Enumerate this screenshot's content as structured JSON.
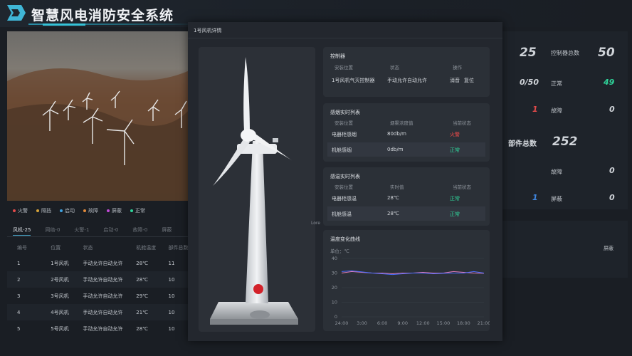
{
  "header": {
    "title": "智慧风电消防安全系统"
  },
  "legend": [
    {
      "label": "火警",
      "color": "#e24a4a"
    },
    {
      "label": "隔挡",
      "color": "#d6a33a"
    },
    {
      "label": "启动",
      "color": "#3fa2e0"
    },
    {
      "label": "故障",
      "color": "#e0893a"
    },
    {
      "label": "屏蔽",
      "color": "#c24ad8"
    },
    {
      "label": "正常",
      "color": "#2fd49a"
    }
  ],
  "filter_tabs": [
    "风机-25",
    "网络-0",
    "火警-1",
    "启动-0",
    "故障-0",
    "屏蔽"
  ],
  "table": {
    "headers": [
      "编号",
      "位置",
      "状态",
      "机舱温度",
      "部件总数"
    ],
    "rows": [
      [
        "1",
        "1号风机",
        "手动允许自动允许",
        "28℃",
        "11"
      ],
      [
        "2",
        "2号风机",
        "手动允许自动允许",
        "28℃",
        "10"
      ],
      [
        "3",
        "3号风机",
        "手动允许自动允许",
        "29℃",
        "10"
      ],
      [
        "4",
        "4号风机",
        "手动允许自动允许",
        "21℃",
        "10"
      ],
      [
        "5",
        "5号风机",
        "手动允许自动允许",
        "28℃",
        "10"
      ]
    ]
  },
  "right_stats": {
    "v25": "25",
    "controller_total_label": "控制器总数",
    "controller_total": "50",
    "ratio": "0/50",
    "normal_label": "正常",
    "normal_value": "49",
    "red1": "1",
    "fault_label": "故障",
    "fault_value": "0",
    "parts_total_label": "部件总数",
    "parts_total": "252",
    "fault2_label": "故障",
    "fault2_value": "0",
    "blue1": "1",
    "shield_label": "屏蔽",
    "shield_value": "0",
    "shield2_label": "屏蔽"
  },
  "modal": {
    "title": "1号风机详情",
    "lore": "Lore",
    "controller": {
      "title": "控制器",
      "headers": [
        "安装位置",
        "状态",
        "操作"
      ],
      "row": {
        "location": "1号风机气灭控制器",
        "status": "手动允许自动允许",
        "mute": "消音",
        "reset": "复位"
      }
    },
    "smoke": {
      "title": "感烟实时列表",
      "headers": [
        "安装位置",
        "烟雾浓度值",
        "当前状态"
      ],
      "rows": [
        {
          "location": "电器柜感烟",
          "value": "80db/m",
          "state": "火警"
        },
        {
          "location": "机舱感烟",
          "value": "0db/m",
          "state": "正常"
        }
      ]
    },
    "temp": {
      "title": "感温实时列表",
      "headers": [
        "安装位置",
        "实时值",
        "当前状态"
      ],
      "rows": [
        {
          "location": "电器柜感温",
          "value": "28℃",
          "state": "正常"
        },
        {
          "location": "机舱感温",
          "value": "28℃",
          "state": "正常"
        }
      ]
    },
    "chart": {
      "title": "温度变化曲线",
      "unit": "单位：℃"
    }
  },
  "chart_data": {
    "type": "line",
    "title": "温度变化曲线",
    "ylabel": "单位：℃",
    "x_ticks": [
      "24:00",
      "3:00",
      "6:00",
      "9:00",
      "12:00",
      "15:00",
      "18:00",
      "21:00"
    ],
    "y_ticks": [
      0,
      5,
      10,
      15,
      20,
      25,
      30,
      35,
      40
    ],
    "ylim": [
      0,
      40
    ],
    "grid": true,
    "series": [
      {
        "color": "#e07ab4",
        "values": [
          30,
          31,
          30.5,
          30,
          30,
          29.5,
          30,
          30,
          30.5,
          30,
          30,
          31,
          30.5,
          30,
          29.8
        ]
      },
      {
        "color": "#4a6cff",
        "values": [
          31,
          31.5,
          30.8,
          30,
          29.5,
          29,
          29.5,
          30,
          30,
          29.5,
          29.8,
          30,
          30,
          31,
          30
        ]
      }
    ]
  }
}
